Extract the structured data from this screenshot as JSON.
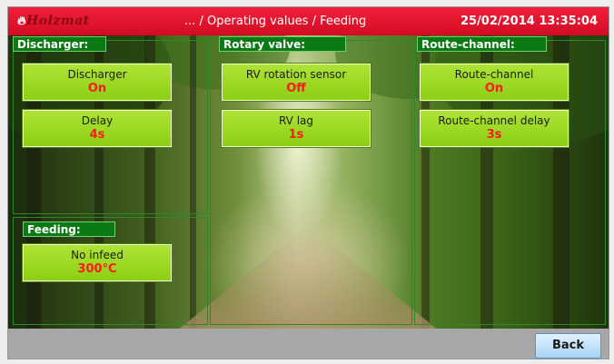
{
  "header": {
    "logo_text": "Holzmat",
    "breadcrumb": "... / Operating values / Feeding",
    "datetime": "25/02/2014 13:35:04",
    "background_color": "#e3142c"
  },
  "sections": {
    "discharger": {
      "title": "Discharger:",
      "tiles": [
        {
          "label": "Discharger",
          "value": "On"
        },
        {
          "label": "Delay",
          "value": "4s"
        }
      ]
    },
    "rotary_valve": {
      "title": "Rotary valve:",
      "tiles": [
        {
          "label": "RV rotation sensor",
          "value": "Off"
        },
        {
          "label": "RV lag",
          "value": "1s"
        }
      ]
    },
    "route_channel": {
      "title": "Route-channel:",
      "tiles": [
        {
          "label": "Route-channel",
          "value": "On"
        },
        {
          "label": "Route-channel delay",
          "value": "3s"
        }
      ]
    },
    "feeding": {
      "title": "Feeding:",
      "tiles": [
        {
          "label": "No infeed",
          "value": "300°C"
        }
      ]
    }
  },
  "footer": {
    "back_label": "Back"
  },
  "colors": {
    "tile_green": "#9ad820",
    "value_red": "#ff1a1a",
    "panel_title_green": "#0c7a14",
    "back_button_blue": "#bfe0fa"
  }
}
